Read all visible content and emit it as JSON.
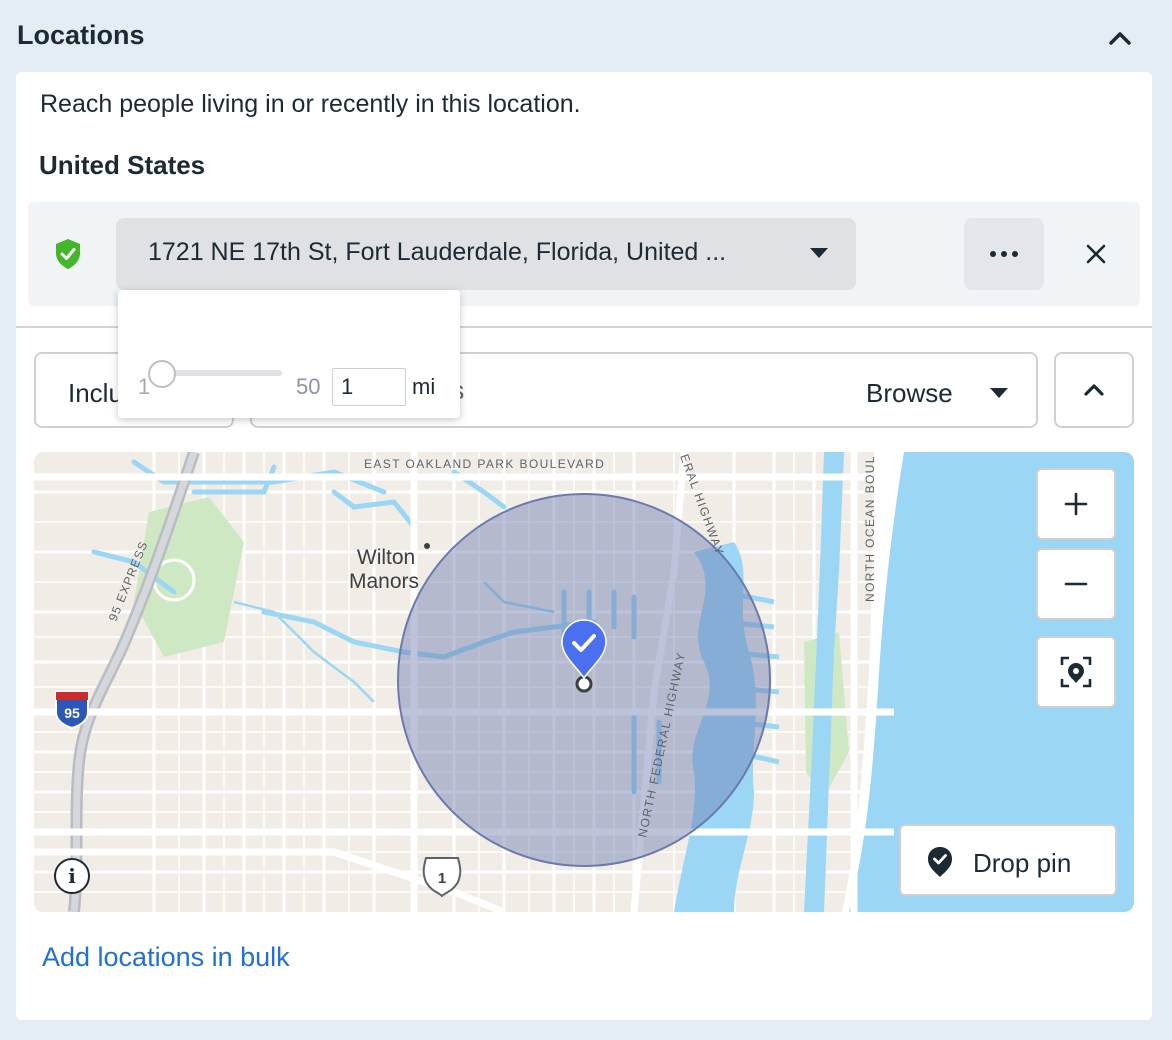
{
  "header": {
    "title": "Locations",
    "collapse_icon": "chevron-up-icon"
  },
  "intro": {
    "description": "Reach people living in or recently in this location.",
    "country": "United States"
  },
  "location": {
    "status_icon": "verified-shield-icon",
    "status_color": "#42b72a",
    "address": "1721 NE 17th St, Fort Lauderdale, Florida, United ...",
    "more_label": "•••",
    "remove_label": "×"
  },
  "radius": {
    "min": "1",
    "max": "50",
    "value": "1",
    "unit": "mi"
  },
  "search": {
    "include_label": "Include",
    "placeholder": "Search locations",
    "browse_label": "Browse"
  },
  "map": {
    "labels": {
      "place": "Wilton Manors",
      "road_top": "EAST OAKLAND PARK BOULEVARD",
      "road_federal": "NORTH FEDERAL HIGHWAY",
      "road_federal_top": "ERAL HIGHWAY",
      "road_ocean": "NORTH OCEAN BOUL",
      "road_express": "95 EXPRESS",
      "shield_95": "95",
      "shield_us1": "1"
    },
    "colors": {
      "water": "#9bd7f5",
      "land": "#f1ede6",
      "park": "#cfe8c4",
      "radius_fill": "#6a7ab0",
      "pin": "#4b70ef"
    },
    "zoom_in": "+",
    "zoom_out": "−",
    "drop_pin_label": "Drop pin",
    "info_label": "i"
  },
  "footer": {
    "bulk_link": "Add locations in bulk"
  }
}
